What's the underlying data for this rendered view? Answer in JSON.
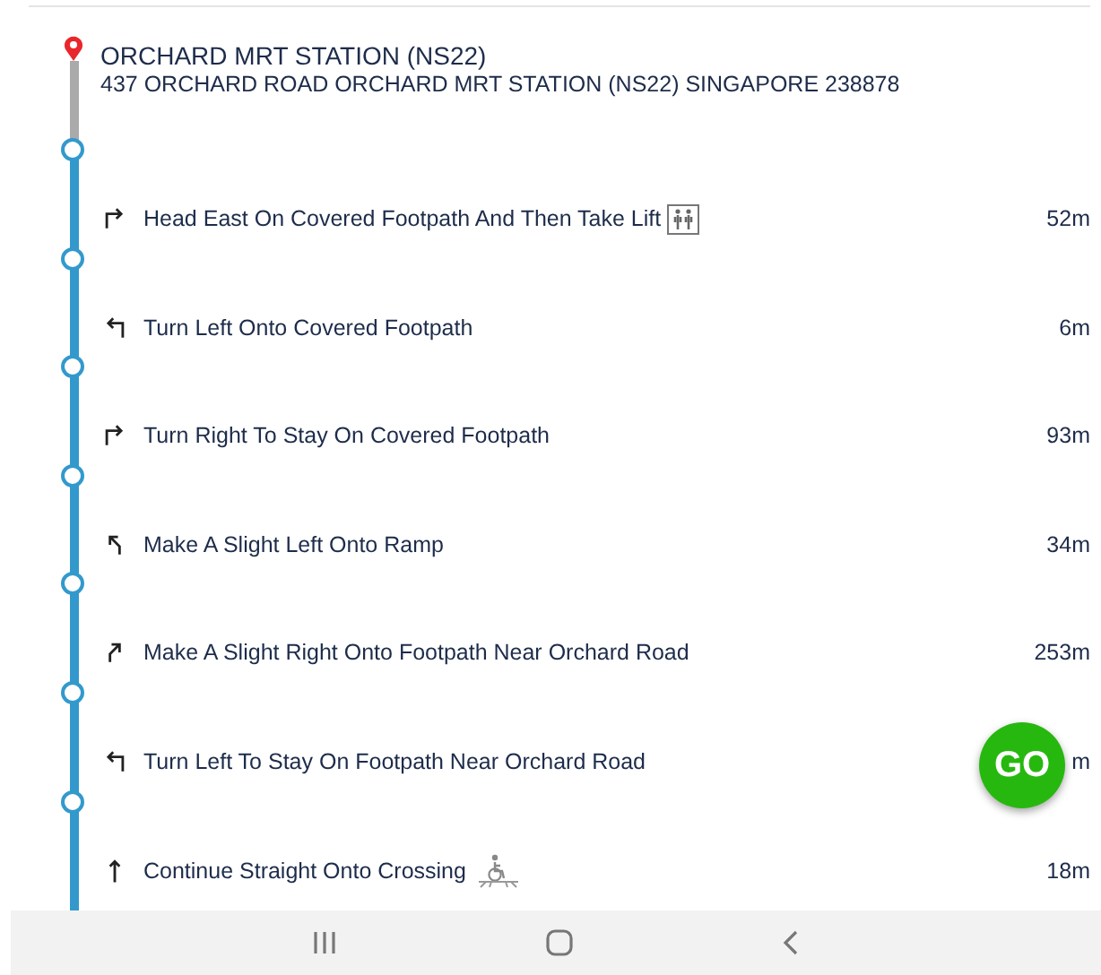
{
  "origin": {
    "name": "ORCHARD MRT STATION (NS22)",
    "address": "437 ORCHARD ROAD ORCHARD MRT STATION (NS22) SINGAPORE 238878"
  },
  "steps": [
    {
      "kind": "right",
      "instruction": "Head East On Covered Footpath And Then Take Lift",
      "feature": {
        "kind": "lift"
      },
      "distance": "52m"
    },
    {
      "kind": "left",
      "instruction": "Turn Left Onto Covered Footpath",
      "distance": "6m"
    },
    {
      "kind": "right",
      "instruction": "Turn Right To Stay On Covered Footpath",
      "distance": "93m"
    },
    {
      "kind": "slight-left",
      "instruction": "Make A Slight Left Onto Ramp",
      "distance": "34m"
    },
    {
      "kind": "slight-right",
      "instruction": "Make A Slight Right Onto Footpath Near Orchard Road",
      "distance": "253m"
    },
    {
      "kind": "left",
      "instruction": "Turn Left To Stay On Footpath Near Orchard Road",
      "distance": "m"
    },
    {
      "kind": "straight",
      "instruction": "Continue Straight Onto Crossing",
      "feature": {
        "kind": "crossing"
      },
      "distance": "18m"
    }
  ],
  "go_button": {
    "label": "GO"
  }
}
